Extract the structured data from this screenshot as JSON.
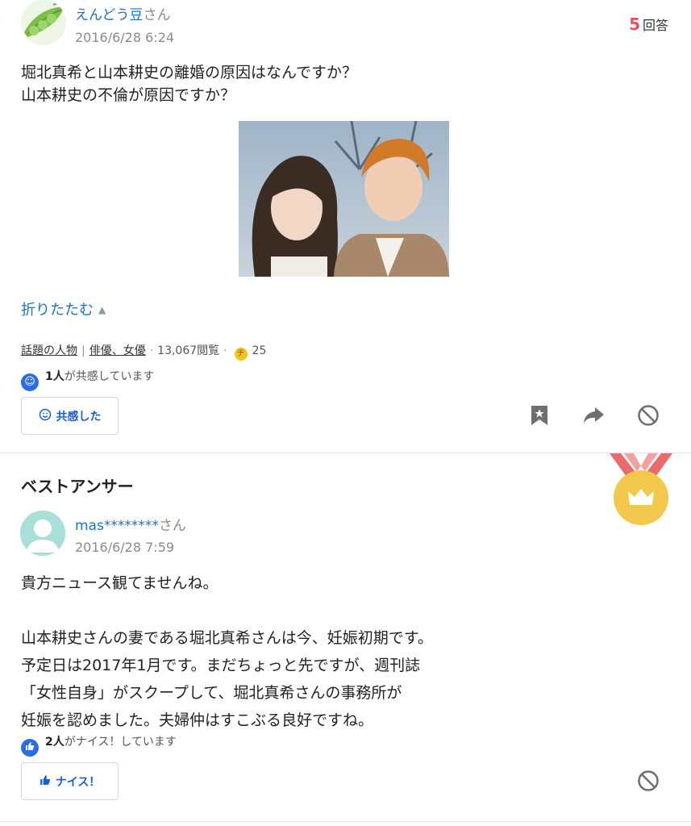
{
  "question": {
    "user_name": "えんどう豆",
    "user_suffix": "さん",
    "date": "2016/6/28 6:24",
    "answers_count": "5",
    "answers_label": "回答",
    "body": "堀北真希と山本耕史の離婚の原因はなんですか？\n山本耕史の不倫が原因ですか？",
    "collapse_label": "折りたたむ",
    "categories": [
      "話題の人物",
      "俳優、女優"
    ],
    "views": "13,067閲覧",
    "coins": "25",
    "empathy_count": "1人",
    "empathy_text": "が共感しています",
    "empathy_button": "共感した"
  },
  "best_answer": {
    "section_title": "ベストアンサー",
    "user_name": "mas********",
    "user_suffix": "さん",
    "date": "2016/6/28 7:59",
    "body": "貴方ニュース観てませんね。\n\n山本耕史さんの妻である堀北真希さんは今、妊娠初期です。\n予定日は2017年1月です。まだちょっと先ですが、週刊誌\n「女性自身」がスクープして、堀北真希さんの事務所が\n妊娠を認めました。夫婦仲はすこぶる良好ですね。",
    "nice_count": "2人",
    "nice_text": "がナイス！しています",
    "nice_button": "ナイス！"
  },
  "colors": {
    "link": "#1a73c8",
    "accent_red": "#e8505b",
    "button_text": "#1a5fc8",
    "medal_gold": "#f2c94c",
    "medal_ribbon": "#e86a6a"
  },
  "icons": [
    "bookmark-icon",
    "share-icon",
    "block-icon",
    "smile-icon",
    "thumbs-up-icon",
    "crown-medal-icon",
    "coin-icon",
    "caret-up-icon"
  ]
}
